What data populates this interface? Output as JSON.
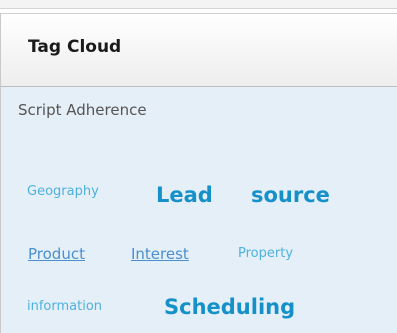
{
  "panel": {
    "title": "Tag Cloud"
  },
  "cloud": {
    "heading": "Script Adherence",
    "tags": [
      {
        "label": "Geography",
        "size": "small"
      },
      {
        "label": "Lead",
        "size": "large"
      },
      {
        "label": "source",
        "size": "large"
      },
      {
        "label": "Product",
        "size": "medium"
      },
      {
        "label": "Interest",
        "size": "medium"
      },
      {
        "label": "Property",
        "size": "small"
      },
      {
        "label": "information",
        "size": "small"
      },
      {
        "label": "Scheduling",
        "size": "large"
      }
    ]
  },
  "colors": {
    "body_background": "#e4eff8",
    "tag_small": "#4fb1dd",
    "tag_medium": "#4a8fcf",
    "tag_large": "#1590c8"
  }
}
